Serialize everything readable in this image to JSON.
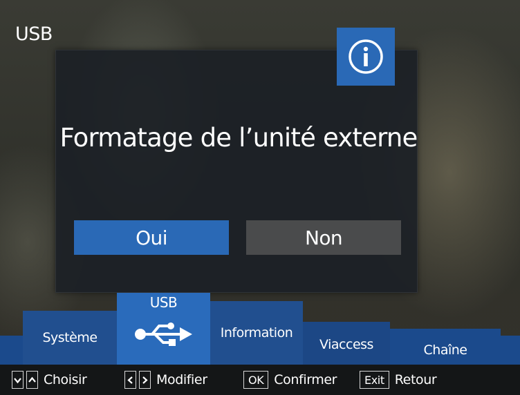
{
  "screen": {
    "title": "USB"
  },
  "dialog": {
    "message": "Formatage de l’unité externe",
    "icon": "info-icon",
    "yes_label": "Oui",
    "no_label": "Non"
  },
  "menu": {
    "tabs": [
      {
        "label": "Système"
      },
      {
        "label": "USB",
        "icon": "usb-icon",
        "selected": true
      },
      {
        "label": "Information"
      },
      {
        "label": "Viaccess"
      },
      {
        "label": "Chaîne"
      }
    ]
  },
  "keys": {
    "choose": {
      "keys": [
        "v",
        "^"
      ],
      "label": "Choisir"
    },
    "modify": {
      "keys": [
        "<",
        ">"
      ],
      "label": "Modifier"
    },
    "confirm": {
      "key": "OK",
      "label": "Confirmer"
    },
    "back": {
      "key": "Exit",
      "label": "Retour"
    }
  },
  "colors": {
    "accent": "#2a69b6",
    "button_inactive": "#4a4b4c",
    "menu_strip": "#1b4a8c"
  }
}
